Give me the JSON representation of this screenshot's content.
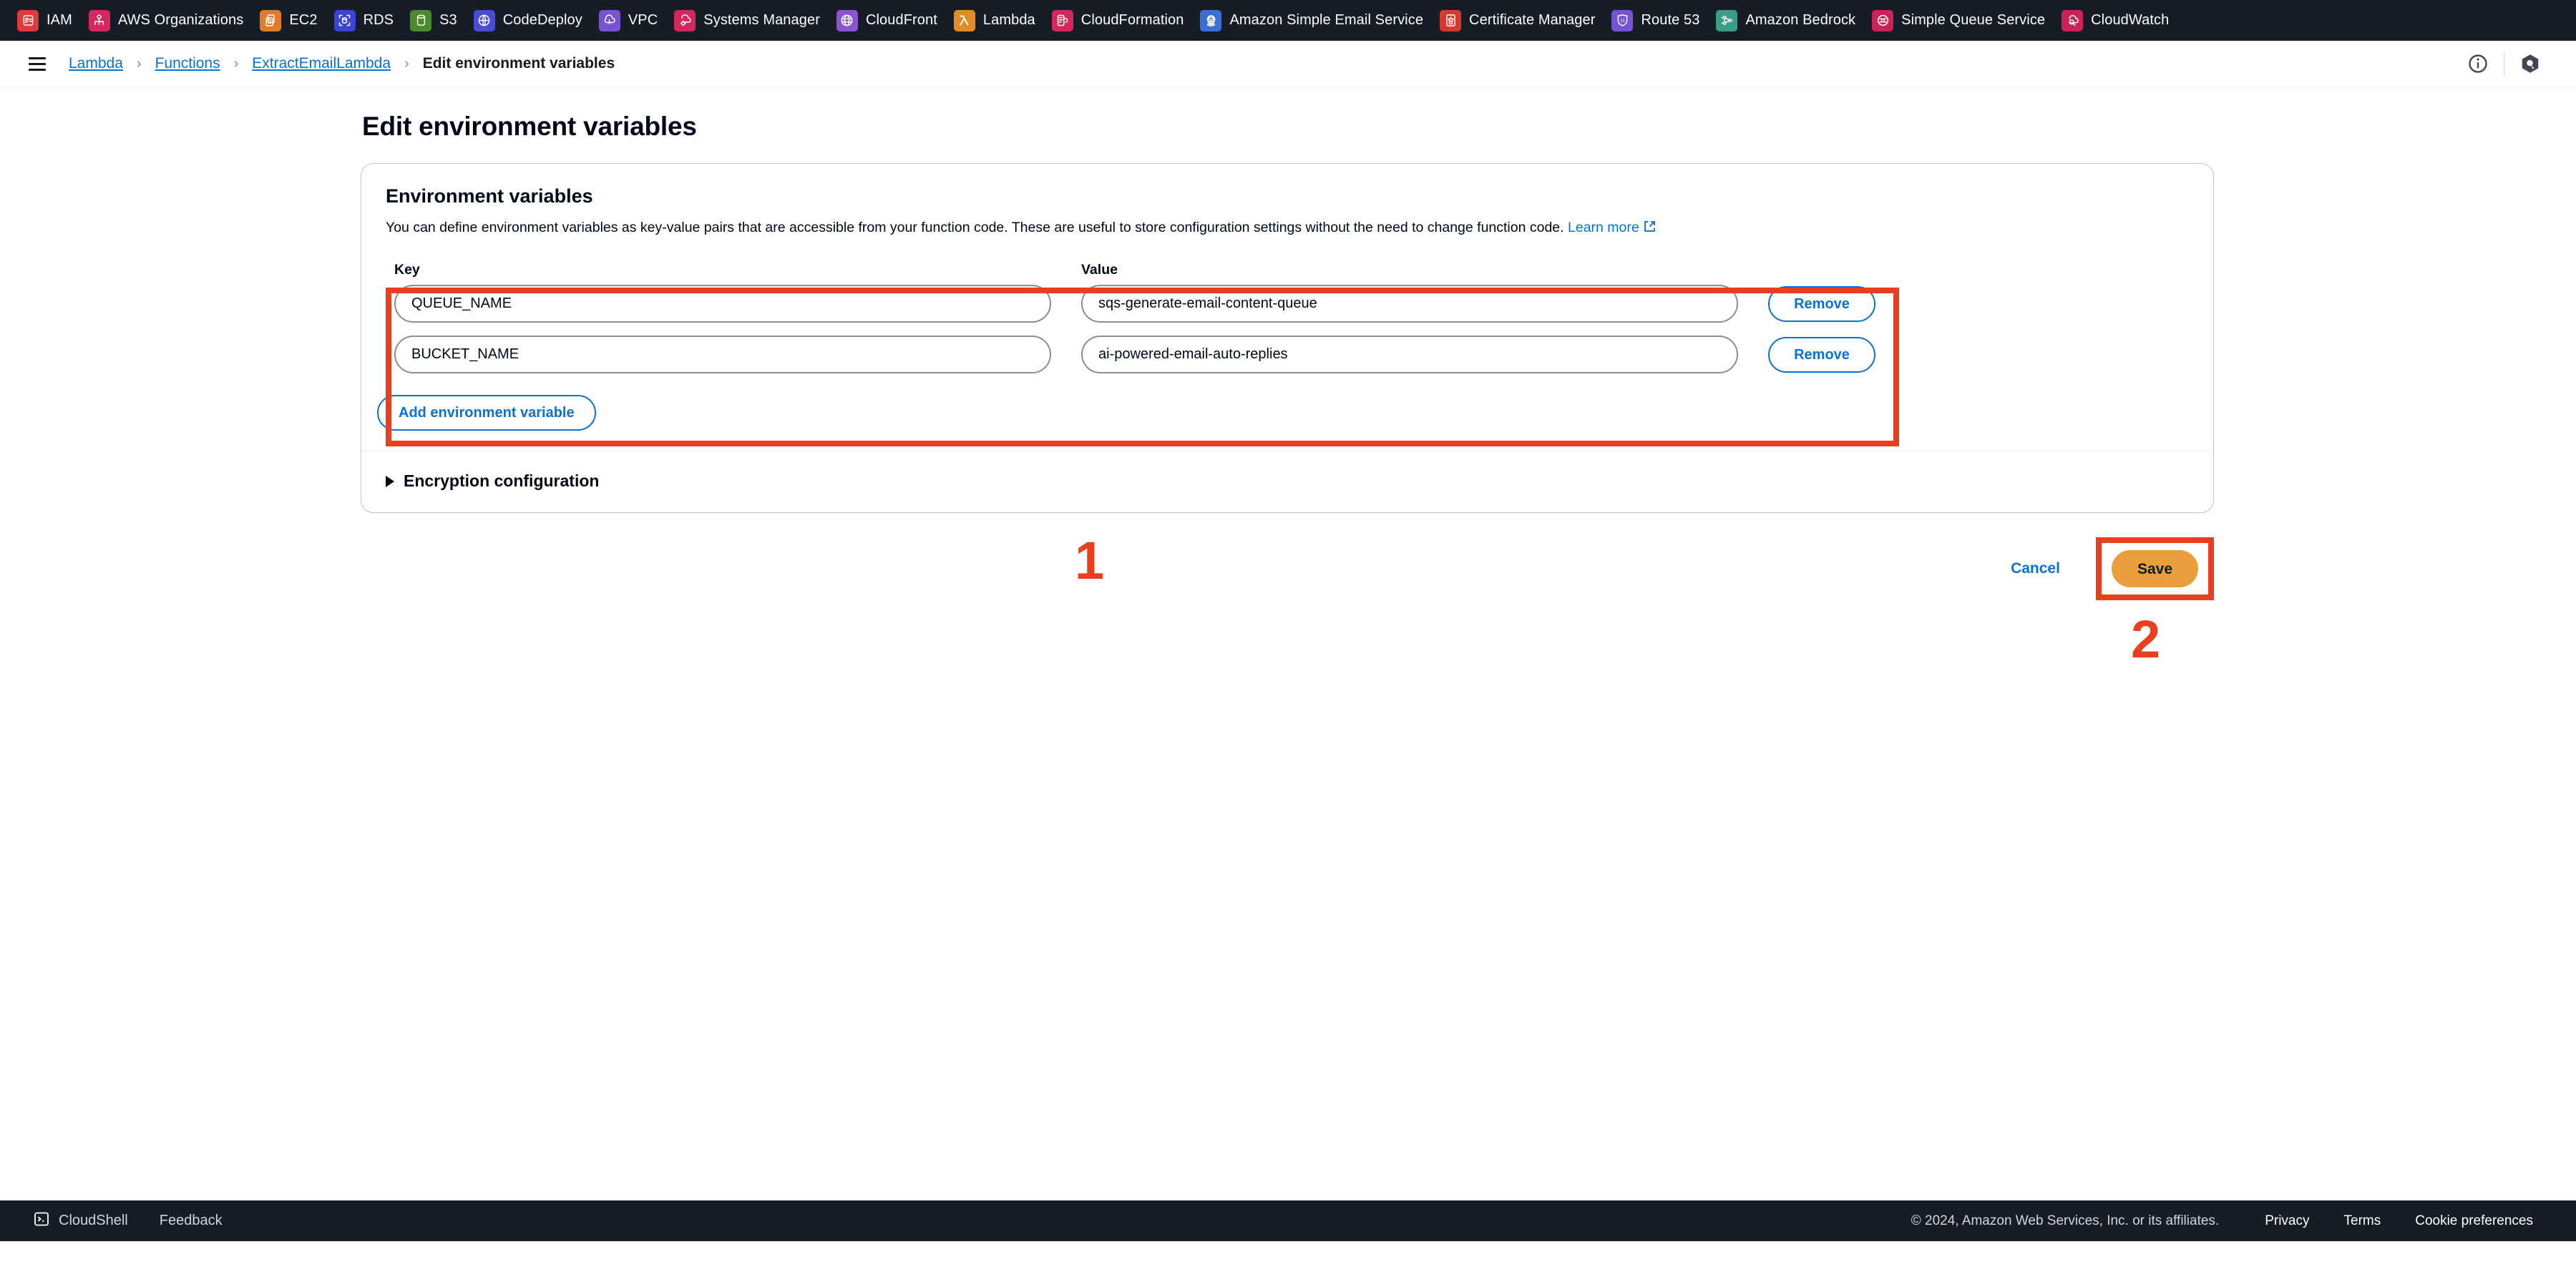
{
  "service_bar": {
    "items": [
      {
        "label": "IAM",
        "icon": "iam-icon",
        "color": "#dd3b3b"
      },
      {
        "label": "AWS Organizations",
        "icon": "organizations-icon",
        "color": "#d6265e"
      },
      {
        "label": "EC2",
        "icon": "ec2-icon",
        "color": "#e07b28"
      },
      {
        "label": "RDS",
        "icon": "rds-icon",
        "color": "#3a43d6"
      },
      {
        "label": "S3",
        "icon": "s3-icon",
        "color": "#4a8a2c"
      },
      {
        "label": "CodeDeploy",
        "icon": "codedeploy-icon",
        "color": "#4b4bd6"
      },
      {
        "label": "VPC",
        "icon": "vpc-icon",
        "color": "#7552d6"
      },
      {
        "label": "Systems Manager",
        "icon": "systems-manager-icon",
        "color": "#d6265e"
      },
      {
        "label": "CloudFront",
        "icon": "cloudfront-icon",
        "color": "#8b52d6"
      },
      {
        "label": "Lambda",
        "icon": "lambda-icon",
        "color": "#e08c28"
      },
      {
        "label": "CloudFormation",
        "icon": "cloudformation-icon",
        "color": "#d6265e"
      },
      {
        "label": "Amazon Simple Email Service",
        "icon": "ses-icon",
        "color": "#3a6fd6"
      },
      {
        "label": "Certificate Manager",
        "icon": "certificate-manager-icon",
        "color": "#d63a2f"
      },
      {
        "label": "Route 53",
        "icon": "route53-icon",
        "color": "#7552d6"
      },
      {
        "label": "Amazon Bedrock",
        "icon": "bedrock-icon",
        "color": "#3a9e86"
      },
      {
        "label": "Simple Queue Service",
        "icon": "sqs-icon",
        "color": "#cc2258"
      },
      {
        "label": "CloudWatch",
        "icon": "cloudwatch-icon",
        "color": "#cc2258"
      }
    ]
  },
  "breadcrumb": {
    "menu_icon": "hamburger-icon",
    "items": [
      {
        "label": "Lambda",
        "link": true
      },
      {
        "label": "Functions",
        "link": true
      },
      {
        "label": "ExtractEmailLambda",
        "link": true
      },
      {
        "label": "Edit environment variables",
        "link": false
      }
    ],
    "separator": "›",
    "info_icon": "info-icon",
    "q_icon": "amazon-q-icon"
  },
  "page": {
    "title": "Edit environment variables"
  },
  "panel": {
    "title": "Environment variables",
    "description": "You can define environment variables as key-value pairs that are accessible from your function code. These are useful to store configuration settings without the need to change function code.",
    "learn_more_label": "Learn more",
    "columns": {
      "key": "Key",
      "value": "Value"
    },
    "rows": [
      {
        "key": "QUEUE_NAME",
        "value": "sqs-generate-email-content-queue",
        "remove_label": "Remove"
      },
      {
        "key": "BUCKET_NAME",
        "value": "ai-powered-email-auto-replies",
        "remove_label": "Remove"
      }
    ],
    "add_label": "Add environment variable",
    "encryption_label": "Encryption configuration"
  },
  "actions": {
    "cancel_label": "Cancel",
    "save_label": "Save"
  },
  "annotations": {
    "step1": "1",
    "step2": "2",
    "highlight_color": "#e8401f"
  },
  "footer": {
    "cloudshell_label": "CloudShell",
    "cloudshell_icon": "terminal-icon",
    "feedback_label": "Feedback",
    "copyright": "© 2024, Amazon Web Services, Inc. or its affiliates.",
    "links": [
      "Privacy",
      "Terms",
      "Cookie preferences"
    ]
  }
}
